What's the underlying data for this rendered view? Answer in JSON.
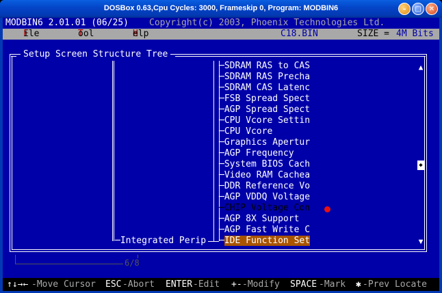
{
  "window": {
    "title": "DOSBox 0.63,Cpu Cycles:    3000, Frameskip  0, Program: MODBIN6"
  },
  "header": {
    "app_version": "MODBIN6 2.01.01 (06/25)",
    "copyright": "Copyright(c) 2003, Phoenix Technologies Ltd."
  },
  "menu": {
    "file_hot": "F",
    "file_rest": "ile",
    "tool_hot": "T",
    "tool_rest": "ool",
    "help_hot": "H",
    "help_rest": "elp",
    "bin_file": "C18.BIN",
    "size_label": "SIZE =",
    "size_value": "4M Bits"
  },
  "panel": {
    "title": "Setup Screen Structure Tree",
    "parent_node": "Integrated Perip",
    "items": [
      {
        "label": "SDRAM RAS to CAS"
      },
      {
        "label": "SDRAM RAS Precha"
      },
      {
        "label": "SDRAM CAS Latenc"
      },
      {
        "label": "FSB Spread Spect"
      },
      {
        "label": "AGP Spread Spect"
      },
      {
        "label": "CPU Vcore Settin"
      },
      {
        "label": "CPU Vcore"
      },
      {
        "label": "Graphics Apertur"
      },
      {
        "label": "AGP Frequency"
      },
      {
        "label": "System BIOS Cach"
      },
      {
        "label": "Video RAM Cachea"
      },
      {
        "label": "DDR Reference Vo"
      },
      {
        "label": "AGP VDDQ Voltage"
      },
      {
        "label": "CHIP Voltage Con"
      },
      {
        "label": "AGP 8X Support"
      },
      {
        "label": "AGP Fast Write C"
      },
      {
        "label": "IDE Function Set"
      }
    ],
    "page_indicator": "6/8"
  },
  "status_bar": {
    "k1": "↑↓→←",
    "d1": "-Move Cursor",
    "k2": "ESC",
    "d2": "-Abort",
    "k3": "ENTER",
    "d3": "-Edit",
    "k4": "+-",
    "d4": "-Modify",
    "k5": "SPACE",
    "d5": "-Mark",
    "k6": "✱",
    "d6": "-Prev Locate"
  },
  "colors": {
    "dos_blue": "#0000a8",
    "menu_gray": "#a8a8a8",
    "highlight": "#a85400",
    "hotkey_red": "#a80000"
  }
}
